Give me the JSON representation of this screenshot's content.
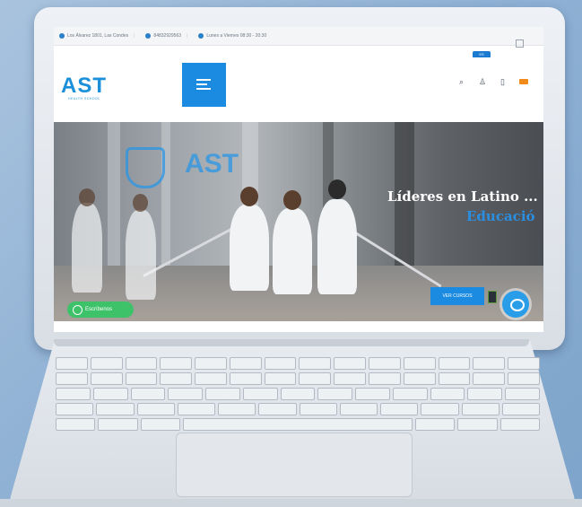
{
  "topbar": {
    "address": "Los Álvarez 1801, Las Condes",
    "phone": "84832929563",
    "hours": "Lunes a Viernes 08:30 - 20:30",
    "lang": "ES"
  },
  "nav": {
    "logo": "AST",
    "logo_sub": "HEALTH SCHOOL"
  },
  "hero": {
    "logo_text": "AST",
    "title": "Líderes en Latino ...",
    "subtitle": "Educació",
    "cta_label": "VER CURSOS",
    "whatsapp_label": "Escríbenos"
  },
  "colors": {
    "brand": "#1a8be0",
    "whatsapp": "#3dc26a",
    "cart_badge": "#f08a1a"
  }
}
